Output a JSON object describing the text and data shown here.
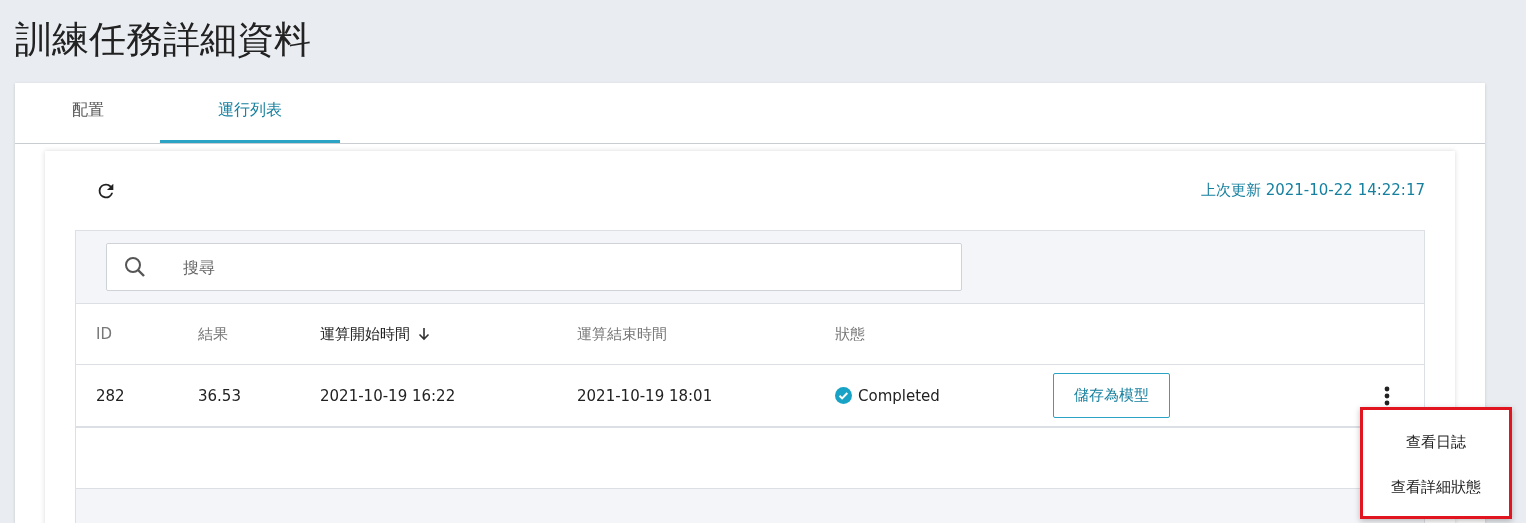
{
  "page_title": "訓練任務詳細資料",
  "tabs": [
    {
      "label": "配置",
      "selected": false
    },
    {
      "label": "運行列表",
      "selected": true
    }
  ],
  "last_updated": "上次更新 2021-10-22 14:22:17",
  "search": {
    "placeholder": "搜尋"
  },
  "table": {
    "columns": [
      {
        "label": "ID",
        "sorted": false
      },
      {
        "label": "結果",
        "sorted": false
      },
      {
        "label": "運算開始時間",
        "sorted": true
      },
      {
        "label": "運算結束時間",
        "sorted": false
      },
      {
        "label": "狀態",
        "sorted": false
      }
    ],
    "rows": [
      {
        "id": "282",
        "result": "36.53",
        "start": "2021-10-19 16:22",
        "end": "2021-10-19 18:01",
        "status": {
          "kind": "completed",
          "label": "Completed"
        },
        "action": "儲存為模型"
      }
    ]
  },
  "row_menu": {
    "items": [
      "查看日誌",
      "查看詳細狀態"
    ]
  }
}
